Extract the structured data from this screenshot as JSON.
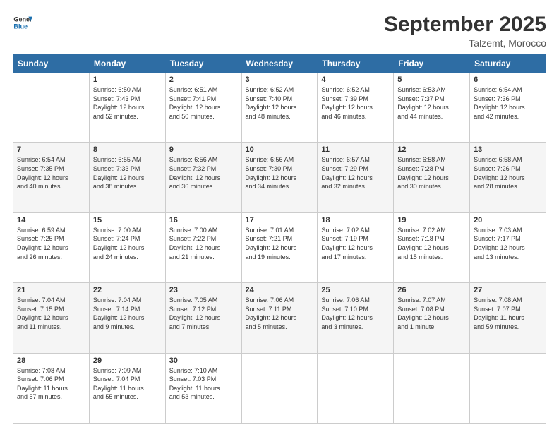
{
  "header": {
    "logo_line1": "General",
    "logo_line2": "Blue",
    "title": "September 2025",
    "subtitle": "Talzemt, Morocco"
  },
  "days_of_week": [
    "Sunday",
    "Monday",
    "Tuesday",
    "Wednesday",
    "Thursday",
    "Friday",
    "Saturday"
  ],
  "weeks": [
    [
      {
        "day": "",
        "info": ""
      },
      {
        "day": "1",
        "info": "Sunrise: 6:50 AM\nSunset: 7:43 PM\nDaylight: 12 hours\nand 52 minutes."
      },
      {
        "day": "2",
        "info": "Sunrise: 6:51 AM\nSunset: 7:41 PM\nDaylight: 12 hours\nand 50 minutes."
      },
      {
        "day": "3",
        "info": "Sunrise: 6:52 AM\nSunset: 7:40 PM\nDaylight: 12 hours\nand 48 minutes."
      },
      {
        "day": "4",
        "info": "Sunrise: 6:52 AM\nSunset: 7:39 PM\nDaylight: 12 hours\nand 46 minutes."
      },
      {
        "day": "5",
        "info": "Sunrise: 6:53 AM\nSunset: 7:37 PM\nDaylight: 12 hours\nand 44 minutes."
      },
      {
        "day": "6",
        "info": "Sunrise: 6:54 AM\nSunset: 7:36 PM\nDaylight: 12 hours\nand 42 minutes."
      }
    ],
    [
      {
        "day": "7",
        "info": "Sunrise: 6:54 AM\nSunset: 7:35 PM\nDaylight: 12 hours\nand 40 minutes."
      },
      {
        "day": "8",
        "info": "Sunrise: 6:55 AM\nSunset: 7:33 PM\nDaylight: 12 hours\nand 38 minutes."
      },
      {
        "day": "9",
        "info": "Sunrise: 6:56 AM\nSunset: 7:32 PM\nDaylight: 12 hours\nand 36 minutes."
      },
      {
        "day": "10",
        "info": "Sunrise: 6:56 AM\nSunset: 7:30 PM\nDaylight: 12 hours\nand 34 minutes."
      },
      {
        "day": "11",
        "info": "Sunrise: 6:57 AM\nSunset: 7:29 PM\nDaylight: 12 hours\nand 32 minutes."
      },
      {
        "day": "12",
        "info": "Sunrise: 6:58 AM\nSunset: 7:28 PM\nDaylight: 12 hours\nand 30 minutes."
      },
      {
        "day": "13",
        "info": "Sunrise: 6:58 AM\nSunset: 7:26 PM\nDaylight: 12 hours\nand 28 minutes."
      }
    ],
    [
      {
        "day": "14",
        "info": "Sunrise: 6:59 AM\nSunset: 7:25 PM\nDaylight: 12 hours\nand 26 minutes."
      },
      {
        "day": "15",
        "info": "Sunrise: 7:00 AM\nSunset: 7:24 PM\nDaylight: 12 hours\nand 24 minutes."
      },
      {
        "day": "16",
        "info": "Sunrise: 7:00 AM\nSunset: 7:22 PM\nDaylight: 12 hours\nand 21 minutes."
      },
      {
        "day": "17",
        "info": "Sunrise: 7:01 AM\nSunset: 7:21 PM\nDaylight: 12 hours\nand 19 minutes."
      },
      {
        "day": "18",
        "info": "Sunrise: 7:02 AM\nSunset: 7:19 PM\nDaylight: 12 hours\nand 17 minutes."
      },
      {
        "day": "19",
        "info": "Sunrise: 7:02 AM\nSunset: 7:18 PM\nDaylight: 12 hours\nand 15 minutes."
      },
      {
        "day": "20",
        "info": "Sunrise: 7:03 AM\nSunset: 7:17 PM\nDaylight: 12 hours\nand 13 minutes."
      }
    ],
    [
      {
        "day": "21",
        "info": "Sunrise: 7:04 AM\nSunset: 7:15 PM\nDaylight: 12 hours\nand 11 minutes."
      },
      {
        "day": "22",
        "info": "Sunrise: 7:04 AM\nSunset: 7:14 PM\nDaylight: 12 hours\nand 9 minutes."
      },
      {
        "day": "23",
        "info": "Sunrise: 7:05 AM\nSunset: 7:12 PM\nDaylight: 12 hours\nand 7 minutes."
      },
      {
        "day": "24",
        "info": "Sunrise: 7:06 AM\nSunset: 7:11 PM\nDaylight: 12 hours\nand 5 minutes."
      },
      {
        "day": "25",
        "info": "Sunrise: 7:06 AM\nSunset: 7:10 PM\nDaylight: 12 hours\nand 3 minutes."
      },
      {
        "day": "26",
        "info": "Sunrise: 7:07 AM\nSunset: 7:08 PM\nDaylight: 12 hours\nand 1 minute."
      },
      {
        "day": "27",
        "info": "Sunrise: 7:08 AM\nSunset: 7:07 PM\nDaylight: 11 hours\nand 59 minutes."
      }
    ],
    [
      {
        "day": "28",
        "info": "Sunrise: 7:08 AM\nSunset: 7:06 PM\nDaylight: 11 hours\nand 57 minutes."
      },
      {
        "day": "29",
        "info": "Sunrise: 7:09 AM\nSunset: 7:04 PM\nDaylight: 11 hours\nand 55 minutes."
      },
      {
        "day": "30",
        "info": "Sunrise: 7:10 AM\nSunset: 7:03 PM\nDaylight: 11 hours\nand 53 minutes."
      },
      {
        "day": "",
        "info": ""
      },
      {
        "day": "",
        "info": ""
      },
      {
        "day": "",
        "info": ""
      },
      {
        "day": "",
        "info": ""
      }
    ]
  ]
}
